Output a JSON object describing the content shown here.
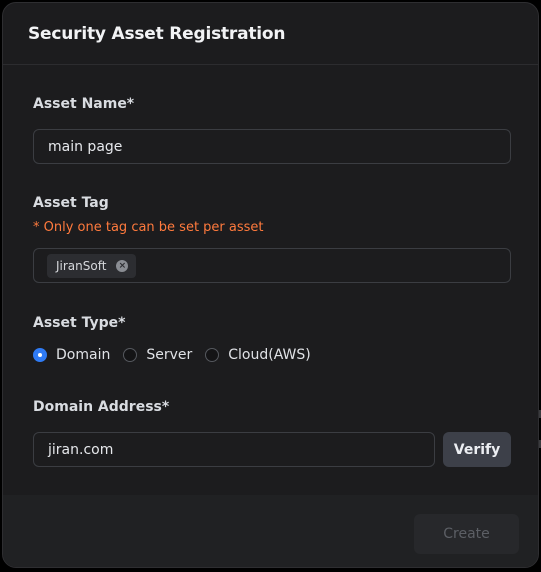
{
  "modal": {
    "title": "Security Asset Registration"
  },
  "asset_name": {
    "label": "Asset Name*",
    "value": "main page"
  },
  "asset_tag": {
    "label": "Asset Tag",
    "hint": "* Only one tag can be set per asset",
    "tags": [
      "JiranSoft"
    ],
    "remove_glyph": "×"
  },
  "asset_type": {
    "label": "Asset Type*",
    "options": [
      "Domain",
      "Server",
      "Cloud(AWS)"
    ],
    "selected": "Domain"
  },
  "domain_address": {
    "label": "Domain Address*",
    "value": "jiran.com",
    "verify_label": "Verify"
  },
  "footer": {
    "create_label": "Create"
  },
  "colors": {
    "background": "#1c1c1e",
    "hint": "#ff7a3d",
    "radio_selected": "#2f7bf5",
    "verify_button": "#3d4049"
  },
  "icons": {
    "tag_remove": "close-circle-icon"
  }
}
